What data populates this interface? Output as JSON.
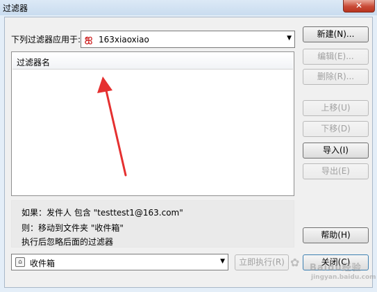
{
  "window": {
    "title": "过滤器",
    "close_label": "✕"
  },
  "account": {
    "label": "下列过滤器应用于:",
    "icon": "netease-logo-icon",
    "value": "163xiaoxiao"
  },
  "filter_list": {
    "column_header": "过滤器名",
    "rows": []
  },
  "description": {
    "line1": "如果：发件人 包含 \"testtest1@163.com\"",
    "line2": "则：移动到文件夹 \"收件箱\"",
    "line3": "执行后忽略后面的过滤器"
  },
  "folder": {
    "value": "收件箱",
    "icon": "folder-icon"
  },
  "buttons": {
    "new": "新建(N)...",
    "edit": "编辑(E)...",
    "delete": "删除(R)...",
    "move_up": "上移(U)",
    "move_down": "下移(D)",
    "import": "导入(I)",
    "export": "导出(E)",
    "help": "帮助(H)",
    "run_now": "立即执行(R)",
    "close": "关闭(C)"
  },
  "annotation": {
    "color": "#e53030"
  },
  "watermark": {
    "text": "Baidu经验",
    "url": "jingyan.baidu.com"
  }
}
